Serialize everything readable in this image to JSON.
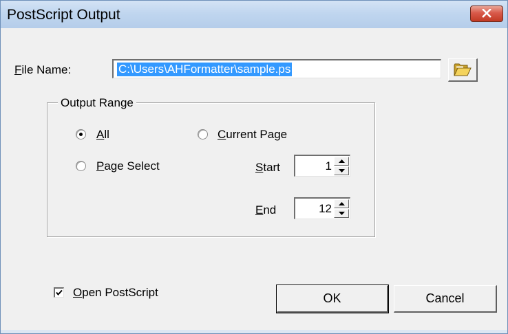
{
  "window": {
    "title": "PostScript Output"
  },
  "file": {
    "label": "File Name:",
    "label_mnemonic": "F",
    "label_rest": "ile Name:",
    "value": "C:\\Users\\AHFormatter\\sample.ps"
  },
  "output_range": {
    "legend": "Output Range",
    "all": {
      "label": "All",
      "mnemonic": "A",
      "rest": "ll",
      "selected": true
    },
    "current_page": {
      "label": "Current Page",
      "mnemonic": "C",
      "rest": "urrent Page",
      "selected": false
    },
    "page_select": {
      "label": "Page Select",
      "mnemonic": "P",
      "rest": "age Select",
      "selected": false
    },
    "start": {
      "label": "Start",
      "mnemonic": "S",
      "rest": "tart",
      "value": "1"
    },
    "end": {
      "label": "End",
      "mnemonic": "E",
      "rest": "nd",
      "value": "12"
    }
  },
  "open_postscript": {
    "label": "Open PostScript",
    "mnemonic": "O",
    "rest": "pen PostScript",
    "checked": true
  },
  "buttons": {
    "ok": "OK",
    "cancel": "Cancel"
  },
  "icons": {
    "close": "close-icon",
    "folder": "folder-open-icon"
  }
}
